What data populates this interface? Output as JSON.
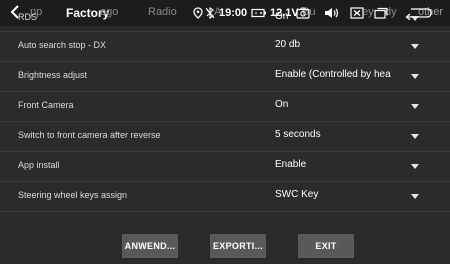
{
  "topbar": {
    "title": "Factory",
    "bg_tabs": [
      "pp",
      "ogo",
      "Radio",
      "A",
      "Bu",
      "ey",
      "dy",
      "other"
    ],
    "time": "19:00",
    "voltage": "12.1V"
  },
  "settings": [
    {
      "label": "RDS",
      "value": "On"
    },
    {
      "label": "Auto search stop - DX",
      "value": "20 db"
    },
    {
      "label": "Brightness adjust",
      "value": "Enable (Controlled by hea"
    },
    {
      "label": "Front Camera",
      "value": "On"
    },
    {
      "label": "Switch to front camera after reverse",
      "value": "5 seconds"
    },
    {
      "label": "App install",
      "value": "Enable"
    },
    {
      "label": "Steering wheel keys assign",
      "value": "SWC Key"
    }
  ],
  "footer": {
    "apply_label": "ANWEND...",
    "export_label": "EXPORTI...",
    "exit_label": "EXIT"
  }
}
